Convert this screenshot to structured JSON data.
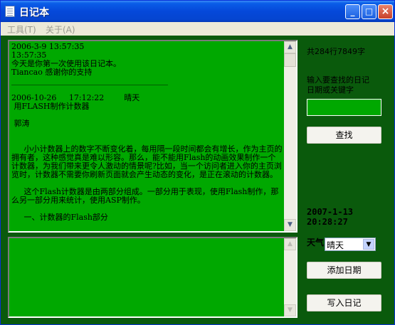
{
  "window": {
    "title": "日记本"
  },
  "titlebar": {
    "min_glyph": "_",
    "max_glyph": "□",
    "close_glyph": "×"
  },
  "menu": {
    "items": [
      "工具(T)",
      "关于(A)"
    ]
  },
  "editor": {
    "content": "2006-3-9 13:57:35\n13:57:35\n今天是你第一次使用该日记本。\nTiancao 感谢你的支持\n________________________________________\n\n2006-10-26     17:12:22        晴天\n 用FLASH制作计数器\n\n 郭涛\n\n\n     小小计数器上的数字不断变化着，每用隔一段时间都会有增长，作为主页的拥有者，这种感觉真是难以形容。那么，能不能用Flash的动画效果制作一个计数器，为我们带来更令人激动的情景呢?比如，当一个访问者进入你的主页浏览时，计数器不需要你刷新页面就会产生动态的变化，是正在滚动的计数器。\n\n     这个Flash计数器是由两部分组成。一部分用于表现，使用Flash制作，那么另一部分用来统计，使用ASP制作。\n\n     一、计数器的Flash部分"
  },
  "new_entry": {
    "content": ""
  },
  "scroll_glyphs": {
    "up": "▲",
    "down": "▼"
  },
  "stats": {
    "text": "共284行7849字"
  },
  "search": {
    "label_line1": "输入要查找的日记",
    "label_line2": "日期或关键字",
    "value": "",
    "button": "查找"
  },
  "clock": {
    "date": "2007-1-13",
    "time": "20:28:27"
  },
  "weather": {
    "label": "天气",
    "selected": "晴天"
  },
  "actions": {
    "add_date": "添加日期",
    "write_diary": "写入日记"
  },
  "colors": {
    "window_bg": "#0a5a0c",
    "text_bg": "#00a800",
    "titlebar": "#0548d9"
  }
}
